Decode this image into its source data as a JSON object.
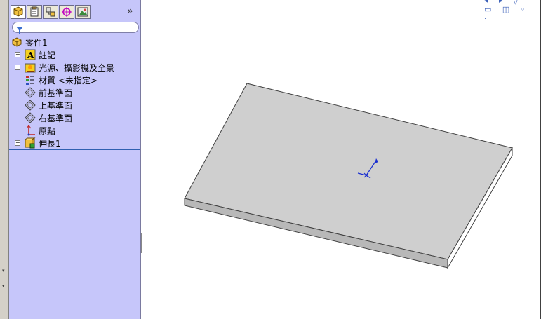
{
  "feature_manager": {
    "tabs": [
      "featuremanager-tab",
      "propertymanager-tab",
      "configurationmanager-tab",
      "dimxpert-tab",
      "display-manager-tab"
    ],
    "expand_glyph": "»",
    "filter_placeholder": "",
    "tree": [
      {
        "label": "零件1",
        "icon": "part-icon",
        "expandable": false
      },
      {
        "label": "註記",
        "icon": "annotations-icon",
        "expandable": true
      },
      {
        "label": "光源、攝影機及全景",
        "icon": "lights-cameras-icon",
        "expandable": true
      },
      {
        "label": "材質 <未指定>",
        "icon": "material-icon",
        "expandable": false
      },
      {
        "label": "前基準面",
        "icon": "plane-icon",
        "expandable": false
      },
      {
        "label": "上基準面",
        "icon": "plane-icon",
        "expandable": false
      },
      {
        "label": "右基準面",
        "icon": "plane-icon",
        "expandable": false
      },
      {
        "label": "原點",
        "icon": "origin-icon",
        "expandable": false
      },
      {
        "label": "伸長1",
        "icon": "extrude-icon",
        "expandable": true
      }
    ]
  },
  "colors": {
    "panel_bg": "#c6c6fa",
    "plate_top": "#cfcfcf",
    "plate_side": "#b8b8b8",
    "triad": "#1a2fd0",
    "separator": "#2f5fb0"
  }
}
